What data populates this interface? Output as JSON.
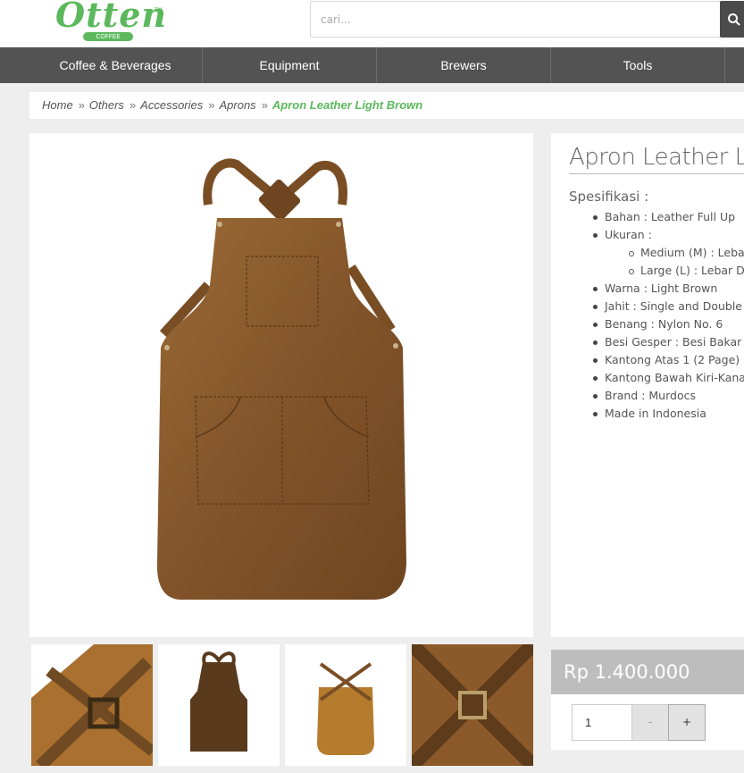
{
  "brand": {
    "logo_text": "Otten",
    "logo_tm": "TM",
    "logo_sub": "COFFEE"
  },
  "search": {
    "placeholder": "cari...",
    "button_icon": "search-icon"
  },
  "nav": {
    "items": [
      "Coffee & Beverages",
      "Equipment",
      "Brewers",
      "Tools"
    ]
  },
  "breadcrumb": {
    "items": [
      "Home",
      "Others",
      "Accessories",
      "Aprons"
    ],
    "separator": "»",
    "current": "Apron Leather Light Brown"
  },
  "product": {
    "title": "Apron Leather Light Brown",
    "spec_heading": "Spesifikasi :",
    "specs": [
      "Bahan : Leather Full Up",
      "Ukuran :",
      "Warna : Light Brown",
      "Jahit : Single and Double Se",
      "Benang : Nylon No. 6",
      "Besi Gesper : Besi Bakar Ku",
      "Kantong Atas 1 (2 Page)",
      "Kantong Bawah Kiri-Kanan",
      "Brand : Murdocs",
      "Made in Indonesia"
    ],
    "sizes": [
      "Medium (M) : Lebar",
      "Large (L) : Lebar Dad"
    ],
    "price": "Rp 1.400.000",
    "quantity": "1",
    "minus_label": "-",
    "plus_label": "+"
  },
  "colors": {
    "accent": "#5cb85c",
    "nav_bg": "#535353",
    "leather": "#8a5a2b",
    "price_bar": "#bdbdbd"
  }
}
